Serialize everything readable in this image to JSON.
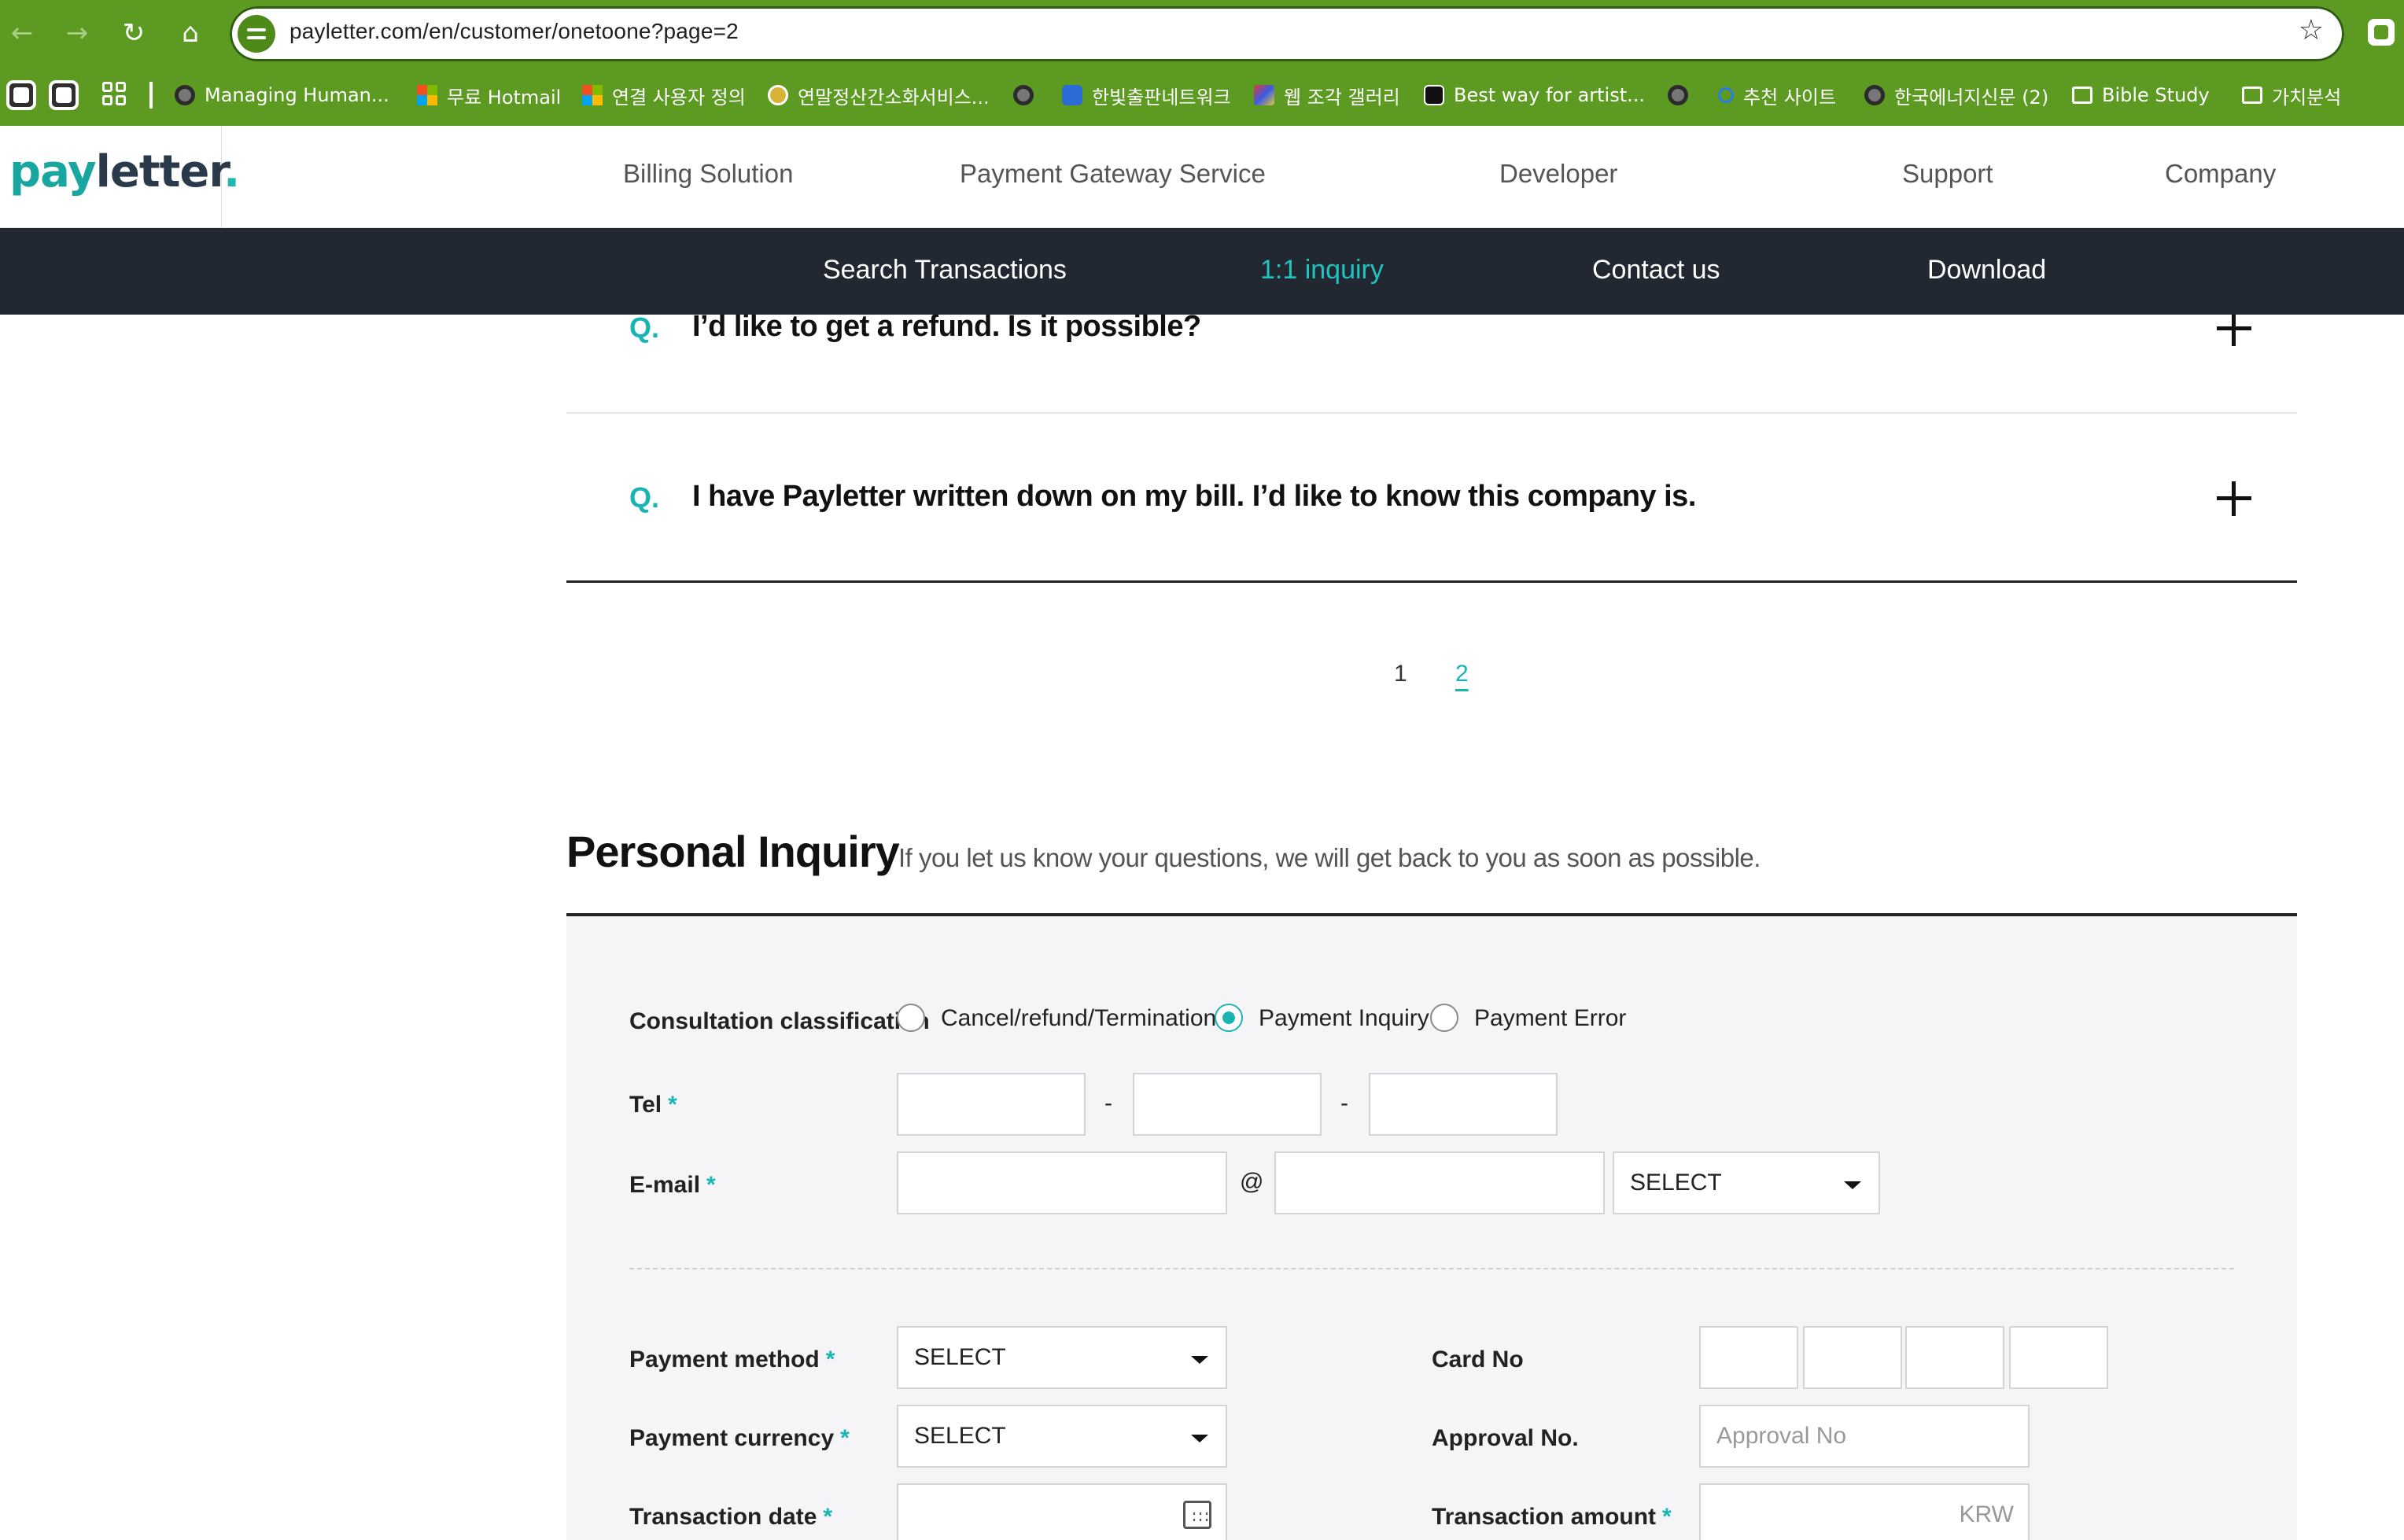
{
  "browser": {
    "url": "payletter.com/en/customer/onetoone?page=2",
    "bookmarks": [
      {
        "label": "Managing Human...",
        "icon": "globe-icon"
      },
      {
        "label": "무료 Hotmail",
        "icon": "microsoft-icon"
      },
      {
        "label": "연결 사용자 정의",
        "icon": "microsoft-icon"
      },
      {
        "label": "연말정산간소화서비스...",
        "icon": "seal-icon"
      },
      {
        "label": "",
        "icon": "globe-icon"
      },
      {
        "label": "한빛출판네트워크",
        "icon": "hanbit-icon"
      },
      {
        "label": "웹 조각 갤러리",
        "icon": "gallery-icon"
      },
      {
        "label": "Best way for artist...",
        "icon": "notion-icon"
      },
      {
        "label": "",
        "icon": "globe-icon"
      },
      {
        "label": "추천 사이트",
        "icon": "search-icon"
      },
      {
        "label": "한국에너지신문 (2)",
        "icon": "globe-icon"
      },
      {
        "label": "Bible Study",
        "icon": "folder-icon"
      },
      {
        "label": "가치분석",
        "icon": "folder-icon"
      }
    ]
  },
  "site": {
    "logo": {
      "pay": "pay",
      "letter": "letter",
      "dot": "."
    },
    "gnb": [
      "Billing Solution",
      "Payment Gateway Service",
      "Developer",
      "Support",
      "Company"
    ],
    "subnav": [
      "Search Transactions",
      "1:1 inquiry",
      "Contact us",
      "Download"
    ],
    "subnav_active": "1:1 inquiry"
  },
  "faq": {
    "q_marker": "Q.",
    "items": [
      "I’d like to get a refund. Is it possible?",
      "I have Payletter written down on my bill. I’d like to know this company is."
    ]
  },
  "pagination": {
    "pages": [
      "1",
      "2"
    ],
    "current": "2"
  },
  "inquiry": {
    "title": "Personal Inquiry",
    "subtitle": "If you let us know your questions, we will get back to you as soon as possible.",
    "consultation_label": "Consultation classification",
    "consultation_options": [
      "Cancel/refund/Termination",
      "Payment Inquiry",
      "Payment Error"
    ],
    "consultation_selected": "Payment Inquiry",
    "required_mark": "*",
    "tel_label": "Tel",
    "tel_separator": "-",
    "email_label": "E-mail",
    "email_at": "@",
    "email_domain_select": "SELECT",
    "payment_method_label": "Payment method",
    "payment_method_value": "SELECT",
    "payment_currency_label": "Payment currency",
    "payment_currency_value": "SELECT",
    "transaction_date_label": "Transaction date",
    "card_no_label": "Card No",
    "approval_no_label": "Approval No.",
    "approval_no_placeholder": "Approval No",
    "transaction_amount_label": "Transaction amount",
    "transaction_amount_unit": "KRW"
  },
  "colors": {
    "accent": "#1ab5b3",
    "chrome": "#5c9a21",
    "subnav_bg": "#222831"
  }
}
